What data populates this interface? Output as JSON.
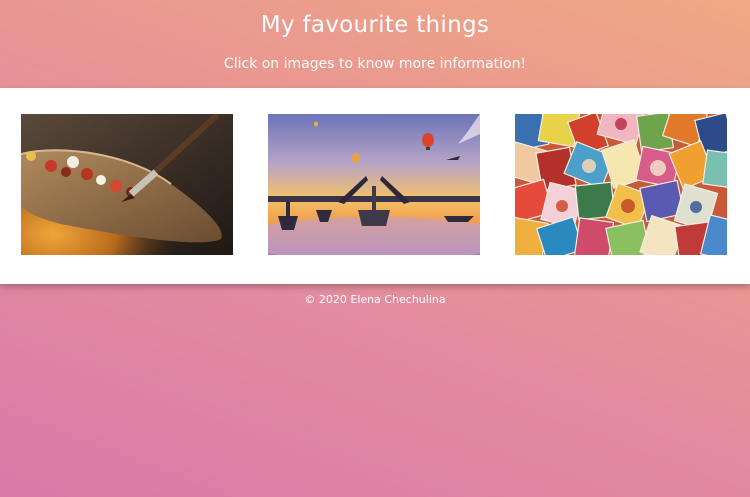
{
  "header": {
    "title": "My favourite things",
    "subtitle": "Click on images to know more information!"
  },
  "gallery": {
    "images": [
      {
        "subject": "paint-palette-brush"
      },
      {
        "subject": "surreal-bridge-balloons"
      },
      {
        "subject": "postage-stamps-collage"
      }
    ]
  },
  "footer": {
    "copyright": "© 2020 Elena Chechulina"
  },
  "colors": {
    "gradient_start": "#d87aa8",
    "gradient_end": "#f0a985",
    "gallery_band": "#ffffff",
    "text": "#ffffff"
  }
}
